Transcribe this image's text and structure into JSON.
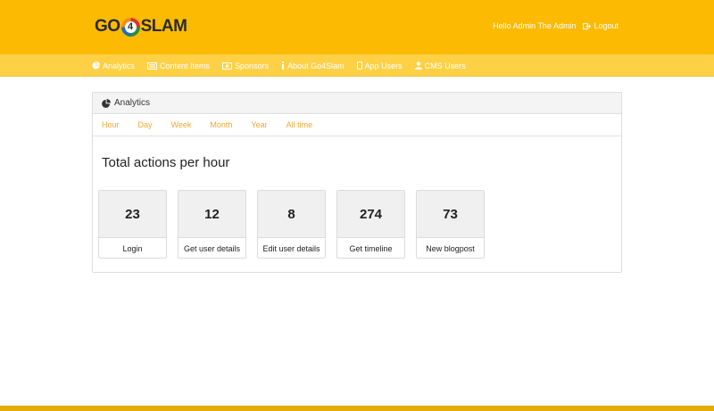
{
  "brand": {
    "logo_left": "GO",
    "logo_mark": "4",
    "logo_right": "SLAM",
    "accent": "#fcba03",
    "nav_bg": "#fdd046",
    "tab_color": "#f0a830"
  },
  "header": {
    "greeting": "Hello Admin The Admin",
    "logout_label": "Logout"
  },
  "nav": {
    "items": [
      {
        "label": "Analytics",
        "icon": "pie-chart-icon"
      },
      {
        "label": "Content Items",
        "icon": "list-card-icon"
      },
      {
        "label": "Sponsors",
        "icon": "money-icon"
      },
      {
        "label": "About Go4Slam",
        "icon": "info-icon"
      },
      {
        "label": "App Users",
        "icon": "mobile-icon"
      },
      {
        "label": "CMS Users",
        "icon": "user-icon"
      }
    ]
  },
  "panel": {
    "title": "Analytics",
    "tabs": [
      "Hour",
      "Day",
      "Week",
      "Month",
      "Year",
      "All time"
    ],
    "section_title": "Total actions per hour",
    "cards": [
      {
        "value": "23",
        "label": "Login"
      },
      {
        "value": "12",
        "label": "Get user details"
      },
      {
        "value": "8",
        "label": "Edit user details"
      },
      {
        "value": "274",
        "label": "Get timeline"
      },
      {
        "value": "73",
        "label": "New blogpost"
      }
    ]
  }
}
